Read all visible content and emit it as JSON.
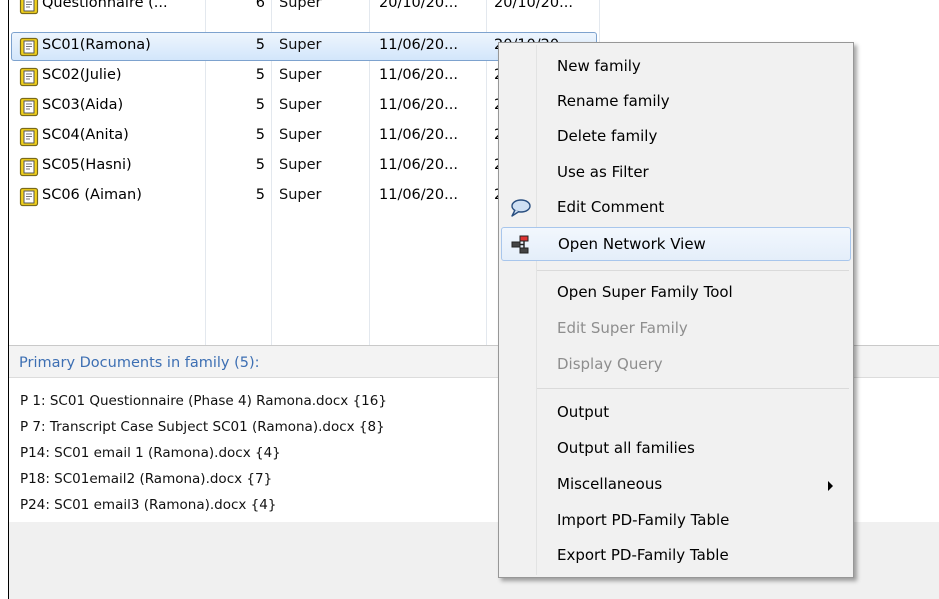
{
  "families": [
    {
      "name": "Questionnaire (...",
      "count": "6",
      "type": "Super",
      "created": "20/10/20...",
      "modified": "20/10/20..."
    },
    {
      "name": "SC01(Ramona)",
      "count": "5",
      "type": "Super",
      "created": "11/06/20...",
      "modified": "20/10/20..."
    },
    {
      "name": "SC02(Julie)",
      "count": "5",
      "type": "Super",
      "created": "11/06/20...",
      "modified": "2..."
    },
    {
      "name": "SC03(Aida)",
      "count": "5",
      "type": "Super",
      "created": "11/06/20...",
      "modified": "2..."
    },
    {
      "name": "SC04(Anita)",
      "count": "5",
      "type": "Super",
      "created": "11/06/20...",
      "modified": "2..."
    },
    {
      "name": "SC05(Hasni)",
      "count": "5",
      "type": "Super",
      "created": "11/06/20...",
      "modified": "2..."
    },
    {
      "name": "SC06 (Aiman)",
      "count": "5",
      "type": "Super",
      "created": "11/06/20...",
      "modified": "2..."
    }
  ],
  "docs_section": {
    "title": "Primary Documents in family (5):",
    "items": [
      "P 1: SC01 Questionnaire (Phase 4) Ramona.docx {16}",
      "P 7: Transcript Case Subject SC01 (Ramona).docx {8}",
      "P14: SC01 email 1 (Ramona).docx {4}",
      "P18: SC01email2 (Ramona).docx {7}",
      "P24: SC01 email3 (Ramona).docx {4}"
    ]
  },
  "context_menu": {
    "new_family": "New family",
    "rename_family": "Rename family",
    "delete_family": "Delete family",
    "use_as_filter": "Use as Filter",
    "edit_comment": "Edit Comment",
    "open_network_view": "Open Network View",
    "open_super_family_tool": "Open Super Family Tool",
    "edit_super_family": "Edit Super Family",
    "display_query": "Display Query",
    "output": "Output",
    "output_all_families": "Output all families",
    "miscellaneous": "Miscellaneous",
    "import_pd_family_table": "Import PD-Family Table",
    "export_pd_family_table": "Export PD-Family Table"
  },
  "icons": {
    "family_icon": "family-document-icon",
    "comment_icon": "speech-bubble-icon",
    "network_icon": "network-view-icon"
  },
  "colors": {
    "selection_border": "#7da2ce",
    "section_title": "#3d6fb3",
    "family_icon_fill": "#f3d21b"
  }
}
